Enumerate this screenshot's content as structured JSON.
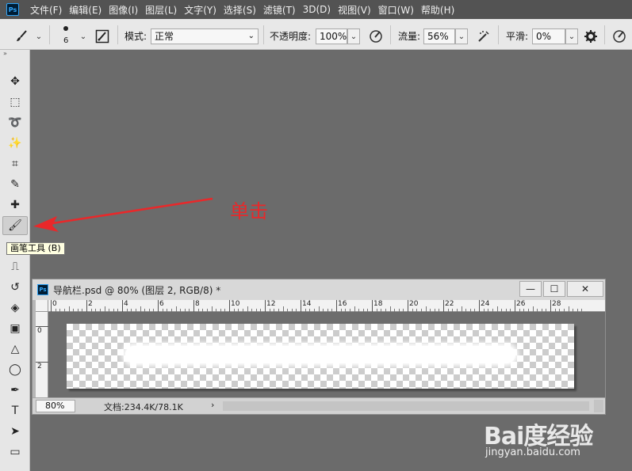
{
  "app": {
    "logo": "Ps"
  },
  "menu": [
    "文件(F)",
    "编辑(E)",
    "图像(I)",
    "图层(L)",
    "文字(Y)",
    "选择(S)",
    "滤镜(T)",
    "3D(D)",
    "视图(V)",
    "窗口(W)",
    "帮助(H)"
  ],
  "options": {
    "brush_size": "6",
    "mode_label": "模式:",
    "mode_value": "正常",
    "opacity_label": "不透明度:",
    "opacity_value": "100%",
    "flow_label": "流量:",
    "flow_value": "56%",
    "smooth_label": "平滑:",
    "smooth_value": "0%"
  },
  "toolbar": {
    "collapse_glyph": "»",
    "tools": [
      {
        "name": "move-tool",
        "glyph": "✥"
      },
      {
        "name": "marquee-tool",
        "glyph": "⬚"
      },
      {
        "name": "lasso-tool",
        "glyph": "➰"
      },
      {
        "name": "magic-wand-tool",
        "glyph": "✨"
      },
      {
        "name": "crop-tool",
        "glyph": "⌗"
      },
      {
        "name": "eyedropper-tool",
        "glyph": "✎"
      },
      {
        "name": "healing-brush-tool",
        "glyph": "✚"
      },
      {
        "name": "brush-tool",
        "glyph": "🖌"
      },
      {
        "name": "clone-stamp-tool",
        "glyph": "⎍"
      },
      {
        "name": "history-brush-tool",
        "glyph": "↺"
      },
      {
        "name": "eraser-tool",
        "glyph": "◈"
      },
      {
        "name": "gradient-tool",
        "glyph": "▣"
      },
      {
        "name": "blur-tool",
        "glyph": "△"
      },
      {
        "name": "dodge-tool",
        "glyph": "◯"
      },
      {
        "name": "pen-tool",
        "glyph": "✒"
      },
      {
        "name": "type-tool",
        "glyph": "T"
      },
      {
        "name": "path-selection-tool",
        "glyph": "➤"
      },
      {
        "name": "shape-tool",
        "glyph": "▭"
      },
      {
        "name": "hand-tool",
        "glyph": "✋"
      },
      {
        "name": "zoom-tool",
        "glyph": "⊕"
      }
    ],
    "active_tool": "brush-tool"
  },
  "tooltip": "画笔工具 (B)",
  "annotation": {
    "text": "单击",
    "color": "#e9282a"
  },
  "document": {
    "title": "导航栏.psd @ 80% (图层 2, RGB/8) *",
    "ruler_top": [
      "0",
      "2",
      "4",
      "6",
      "8",
      "10",
      "12",
      "14",
      "16",
      "18",
      "20",
      "22",
      "24",
      "26",
      "28"
    ],
    "ruler_left": [
      "0",
      "2"
    ],
    "zoom": "80%",
    "doc_info": "文档:234.4K/78.1K",
    "status_arrow": "›",
    "win_buttons": {
      "minimize": "—",
      "restore": "☐",
      "close": "✕"
    }
  },
  "watermark": {
    "logo": "Bai度经验",
    "url": "jingyan.baidu.com"
  }
}
